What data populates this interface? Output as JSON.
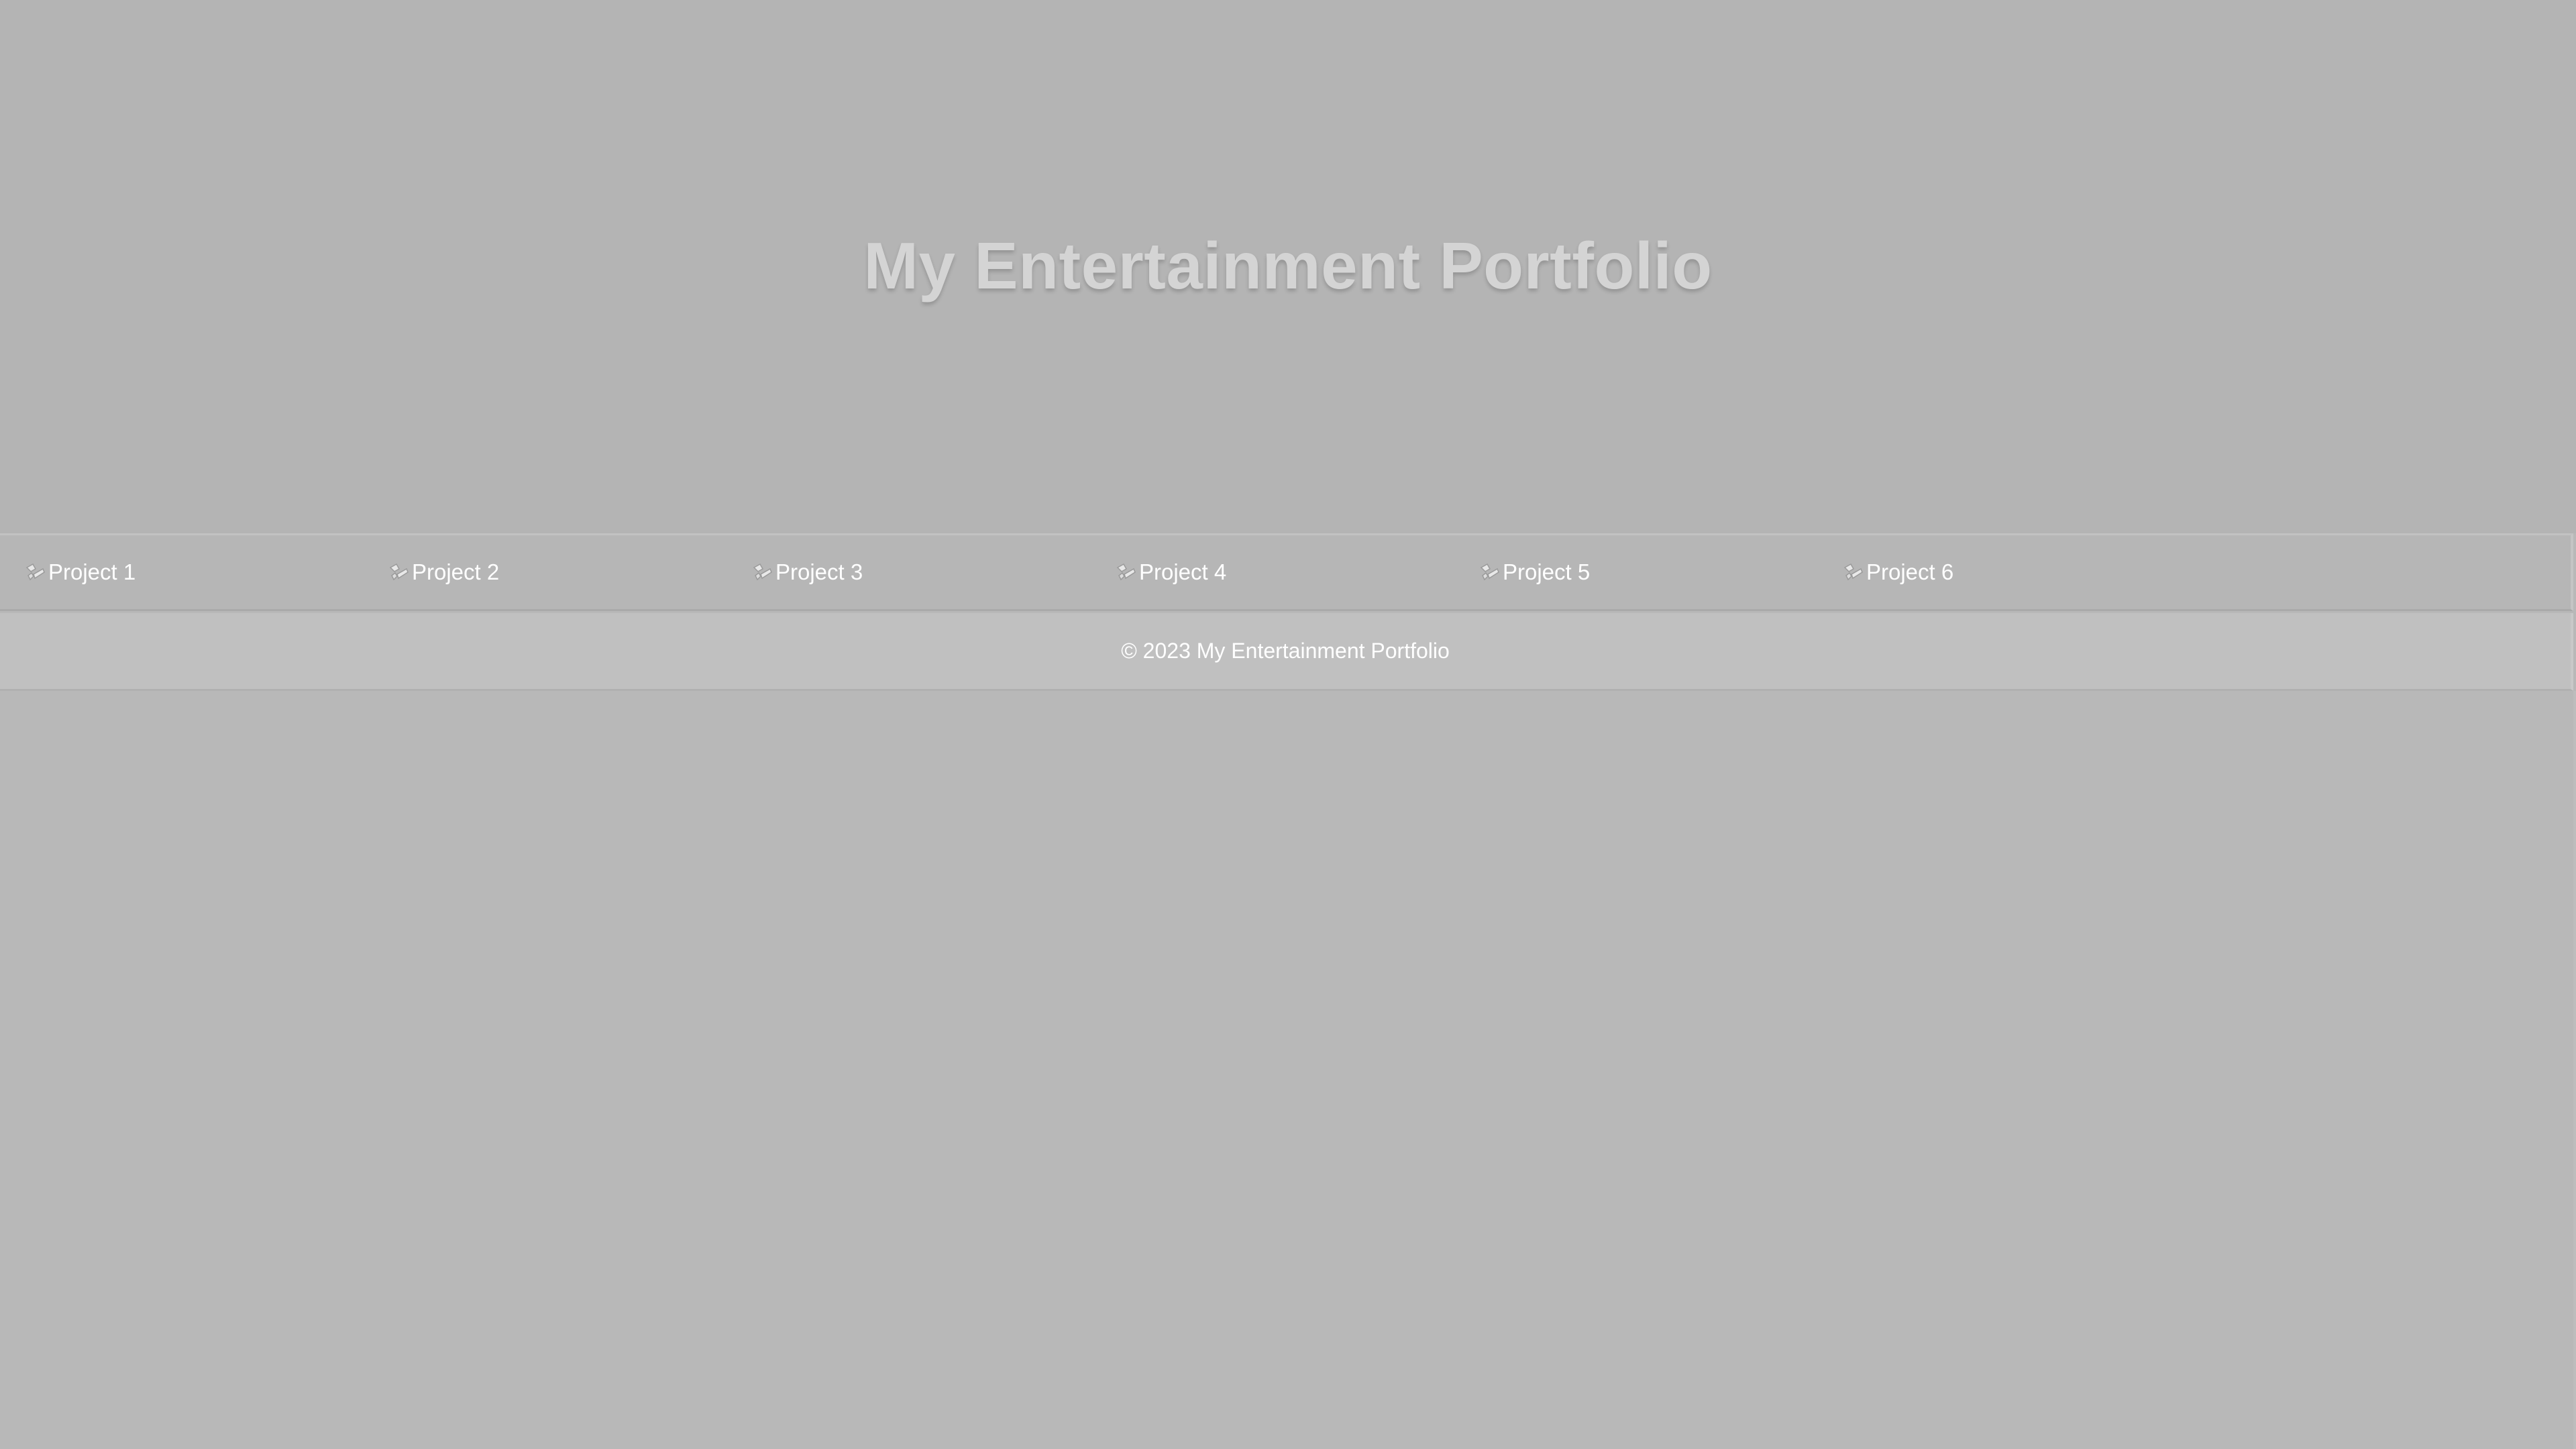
{
  "header": {
    "title": "My Entertainment Portfolio"
  },
  "projects": [
    {
      "alt": "Project 1",
      "icon": "broken-image-icon"
    },
    {
      "alt": "Project 2",
      "icon": "broken-image-icon"
    },
    {
      "alt": "Project 3",
      "icon": "broken-image-icon"
    },
    {
      "alt": "Project 4",
      "icon": "broken-image-icon"
    },
    {
      "alt": "Project 5",
      "icon": "broken-image-icon"
    },
    {
      "alt": "Project 6",
      "icon": "broken-image-icon"
    }
  ],
  "footer": {
    "copyright": "© 2023 My Entertainment Portfolio"
  },
  "colors": {
    "background": "#b8b8b8",
    "hero_title": "#d4d4d4",
    "text": "#ffffff"
  }
}
